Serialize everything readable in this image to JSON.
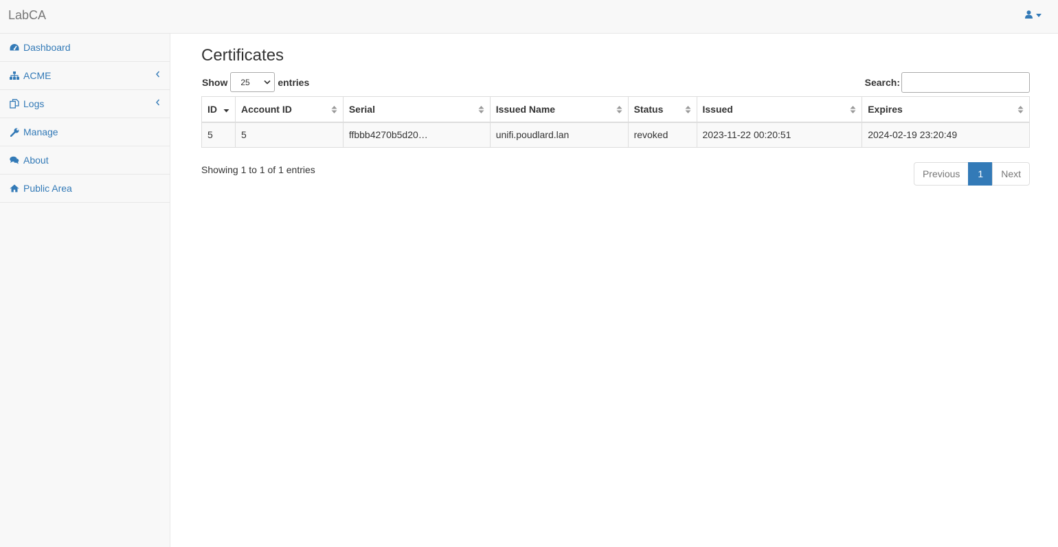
{
  "app": {
    "brand": "LabCA"
  },
  "nav": {
    "items": [
      {
        "label": "Dashboard",
        "icon": "dashboard-icon",
        "expandable": false
      },
      {
        "label": "ACME",
        "icon": "sitemap-icon",
        "expandable": true
      },
      {
        "label": "Logs",
        "icon": "copy-icon",
        "expandable": true
      },
      {
        "label": "Manage",
        "icon": "wrench-icon",
        "expandable": false
      },
      {
        "label": "About",
        "icon": "comments-icon",
        "expandable": false
      },
      {
        "label": "Public Area",
        "icon": "home-icon",
        "expandable": false
      }
    ]
  },
  "page": {
    "title": "Certificates"
  },
  "table_controls": {
    "show_label": "Show",
    "entries_label": "entries",
    "page_length": "25",
    "search_label": "Search:",
    "search_value": ""
  },
  "table": {
    "columns": [
      "ID",
      "Account ID",
      "Serial",
      "Issued Name",
      "Status",
      "Issued",
      "Expires"
    ],
    "sorted_column": "ID",
    "sort_direction": "desc",
    "rows": [
      [
        "5",
        "5",
        "ffbbb4270b5d20…",
        "unifi.poudlard.lan",
        "revoked",
        "2023-11-22 00:20:51",
        "2024-02-19 23:20:49"
      ]
    ]
  },
  "footer": {
    "info": "Showing 1 to 1 of 1 entries",
    "pager": {
      "previous": "Previous",
      "current": "1",
      "next": "Next"
    }
  },
  "colors": {
    "link": "#337ab7",
    "active_page": "#337ab7",
    "navbar_bg": "#f8f8f8"
  }
}
